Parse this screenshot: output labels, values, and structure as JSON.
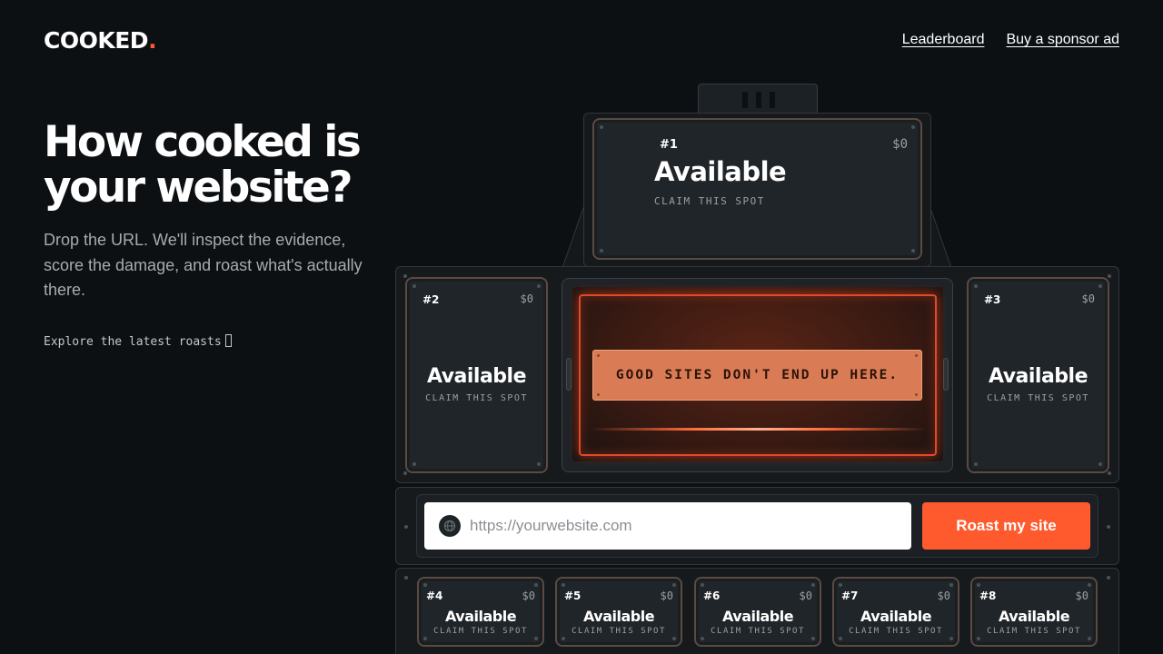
{
  "header": {
    "logo_text": "COOKED",
    "logo_dot": ".",
    "nav": [
      {
        "label": "Leaderboard"
      },
      {
        "label": "Buy a sponsor ad"
      }
    ]
  },
  "hero": {
    "title": "How cooked is your website?",
    "subtitle": "Drop the URL. We'll inspect the evidence, score the damage, and roast what's actually there.",
    "explore_link": "Explore the latest roasts"
  },
  "slots": [
    {
      "rank": "#1",
      "price": "$0",
      "title": "Available",
      "claim": "CLAIM THIS SPOT"
    },
    {
      "rank": "#2",
      "price": "$0",
      "title": "Available",
      "claim": "CLAIM THIS SPOT"
    },
    {
      "rank": "#3",
      "price": "$0",
      "title": "Available",
      "claim": "CLAIM THIS SPOT"
    },
    {
      "rank": "#4",
      "price": "$0",
      "title": "Available",
      "claim": "CLAIM THIS SPOT"
    },
    {
      "rank": "#5",
      "price": "$0",
      "title": "Available",
      "claim": "CLAIM THIS SPOT"
    },
    {
      "rank": "#6",
      "price": "$0",
      "title": "Available",
      "claim": "CLAIM THIS SPOT"
    },
    {
      "rank": "#7",
      "price": "$0",
      "title": "Available",
      "claim": "CLAIM THIS SPOT"
    },
    {
      "rank": "#8",
      "price": "$0",
      "title": "Available",
      "claim": "CLAIM THIS SPOT"
    }
  ],
  "screen": {
    "message": "GOOD SITES DON'T END UP HERE."
  },
  "form": {
    "url_placeholder": "https://yourwebsite.com",
    "submit_label": "Roast my site",
    "globe_icon": "globe-icon"
  },
  "colors": {
    "background": "#0c1013",
    "accent": "#ff5a2e",
    "plate": "#d97c55"
  }
}
